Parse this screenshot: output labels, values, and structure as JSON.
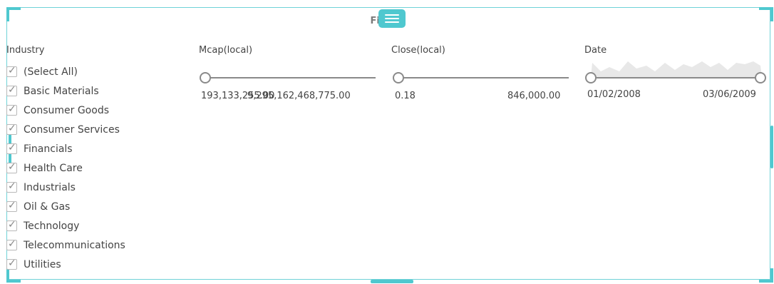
{
  "panel": {
    "title": "Filters"
  },
  "industry": {
    "label": "Industry",
    "items": [
      {
        "label": "(Select All)",
        "checked": true
      },
      {
        "label": "Basic Materials",
        "checked": true
      },
      {
        "label": "Consumer Goods",
        "checked": true
      },
      {
        "label": "Consumer Services",
        "checked": true
      },
      {
        "label": "Financials",
        "checked": true
      },
      {
        "label": "Health Care",
        "checked": true
      },
      {
        "label": "Industrials",
        "checked": true
      },
      {
        "label": "Oil & Gas",
        "checked": true
      },
      {
        "label": "Technology",
        "checked": true
      },
      {
        "label": "Telecommunications",
        "checked": true
      },
      {
        "label": "Utilities",
        "checked": true
      }
    ]
  },
  "mcap": {
    "label": "Mcap(local)",
    "min": "193,133,255.00",
    "max": "9,295,162,468,775.00"
  },
  "close": {
    "label": "Close(local)",
    "min": "0.18",
    "max": "846,000.00"
  },
  "date": {
    "label": "Date",
    "min": "01/02/2008",
    "max": "03/06/2009"
  },
  "colors": {
    "accent": "#4fc8cf",
    "track": "#8a8a8a"
  }
}
